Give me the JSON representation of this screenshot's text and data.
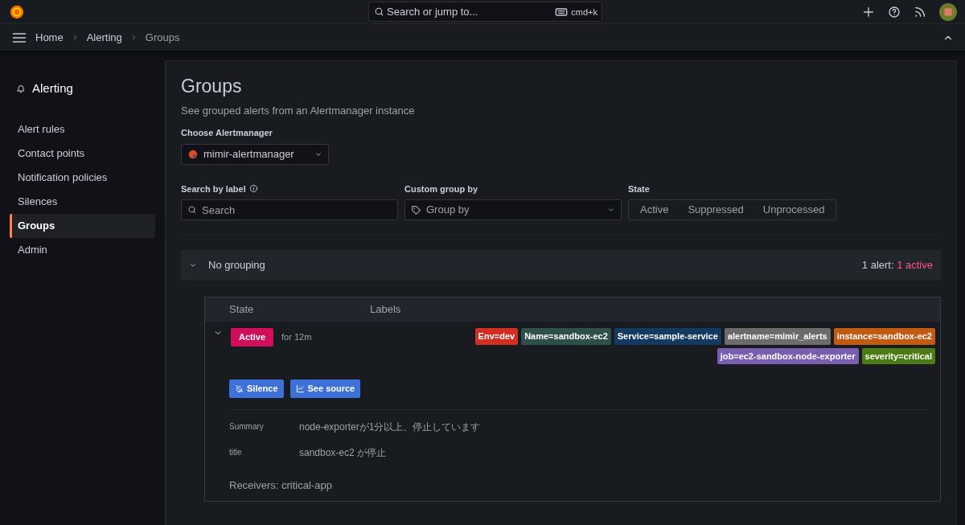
{
  "topbar": {
    "search_placeholder": "Search or jump to...",
    "shortcut": "cmd+k"
  },
  "breadcrumbs": [
    {
      "label": "Home",
      "current": false
    },
    {
      "label": "Alerting",
      "current": false
    },
    {
      "label": "Groups",
      "current": true
    }
  ],
  "sidebar": {
    "title": "Alerting",
    "items": [
      {
        "label": "Alert rules",
        "selected": false
      },
      {
        "label": "Contact points",
        "selected": false
      },
      {
        "label": "Notification policies",
        "selected": false
      },
      {
        "label": "Silences",
        "selected": false
      },
      {
        "label": "Groups",
        "selected": true
      },
      {
        "label": "Admin",
        "selected": false
      }
    ]
  },
  "page": {
    "title": "Groups",
    "subtitle": "See grouped alerts from an Alertmanager instance"
  },
  "alertmanager": {
    "label": "Choose Alertmanager",
    "value": "mimir-alertmanager"
  },
  "filters": {
    "search_label": "Search by label",
    "search_placeholder": "Search",
    "group_label": "Custom group by",
    "group_placeholder": "Group by",
    "state_label": "State",
    "states": [
      {
        "label": "Active",
        "selected": false
      },
      {
        "label": "Suppressed",
        "selected": false
      },
      {
        "label": "Unprocessed",
        "selected": false
      }
    ]
  },
  "group": {
    "title": "No grouping",
    "expanded": true,
    "count_text": "1 alert: ",
    "active_text": "1 active",
    "columns": [
      "State",
      "Labels"
    ],
    "alerts": [
      {
        "state": "Active",
        "duration": "for 12m",
        "expanded": true,
        "labels": [
          {
            "text": "Env=dev",
            "color": "#d12f22"
          },
          {
            "text": "Name=sandbox-ec2",
            "color": "#2f4f4c"
          },
          {
            "text": "Service=sample-service",
            "color": "#153a62"
          },
          {
            "text": "alertname=mimir_alerts",
            "color": "#6b6b6b"
          },
          {
            "text": "instance=sandbox-ec2",
            "color": "#c15a12"
          },
          {
            "text": "job=ec2-sandbox-node-exporter",
            "color": "#7a5fb0"
          },
          {
            "text": "severity=critical",
            "color": "#4b7b12"
          }
        ],
        "actions": [
          {
            "kind": "silence",
            "label": "Silence"
          },
          {
            "kind": "source",
            "label": "See source"
          }
        ],
        "annotations": [
          {
            "key": "Summary",
            "value": "node-exporterが1分以上、停止しています"
          },
          {
            "key": "title",
            "value": "sandbox-ec2 が停止"
          }
        ],
        "receivers": "Receivers: critical-app"
      }
    ]
  }
}
